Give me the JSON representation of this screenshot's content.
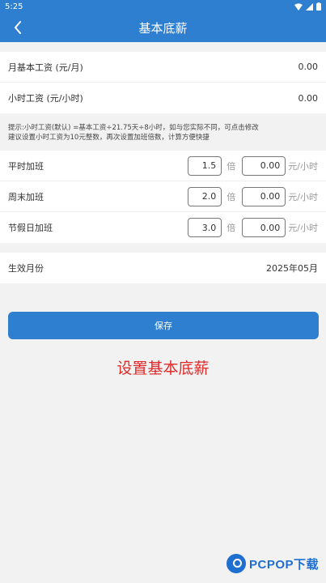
{
  "status": {
    "time": "5:25"
  },
  "header": {
    "title": "基本底薪"
  },
  "salary": [
    {
      "label": "月基本工资 (元/月)",
      "value": "0.00"
    },
    {
      "label": "小时工资 (元/小时)",
      "value": "0.00"
    }
  ],
  "hint": {
    "line1": "提示:小时工资(默认) =基本工资÷21.75天÷8小时，如与您实际不同，可点击修改",
    "line2": "建议设置小时工资为10元整数，再次设置加班倍数，计算方便快捷"
  },
  "overtime": {
    "multiplier_unit": "倍",
    "rate_unit": "元/小时",
    "rows": [
      {
        "label": "平时加班",
        "multiplier": "1.5",
        "rate": "0.00"
      },
      {
        "label": "周末加班",
        "multiplier": "2.0",
        "rate": "0.00"
      },
      {
        "label": "节假日加班",
        "multiplier": "3.0",
        "rate": "0.00"
      }
    ]
  },
  "effective": {
    "label": "生效月份",
    "value": "2025年05月"
  },
  "save_label": "保存",
  "caption": "设置基本底薪",
  "watermark": "PCPOP下载",
  "colors": {
    "primary": "#2f7fd1",
    "caption": "#e02a2a",
    "background": "#f2f2f2"
  }
}
